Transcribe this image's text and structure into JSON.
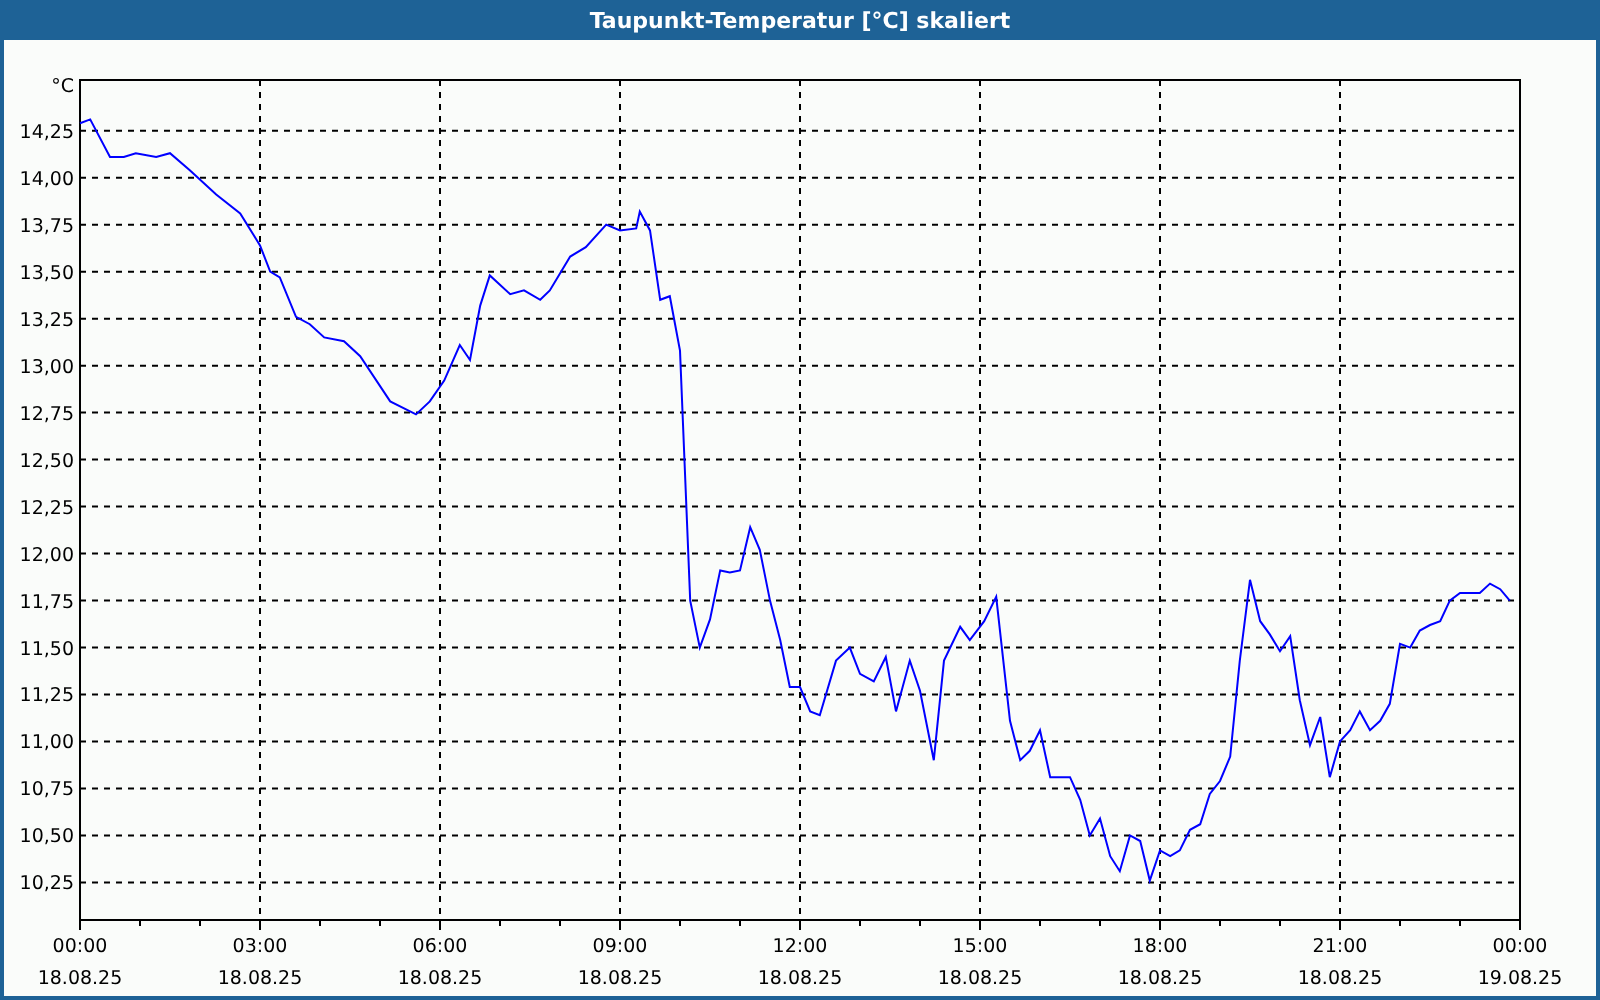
{
  "window": {
    "title": "Taupunkt-Temperatur [°C] skaliert"
  },
  "chart": {
    "date_labels": [
      "18.08.25",
      "18.08.25",
      "18.08.25",
      "18.08.25",
      "18.08.25",
      "18.08.25",
      "18.08.25",
      "18.08.25",
      "19.08.25"
    ],
    "chart_data": {
      "type": "line",
      "ylabel": "°C",
      "x": [
        0,
        0.17,
        0.5,
        0.73,
        0.93,
        1.27,
        1.5,
        1.83,
        2.27,
        2.67,
        3.0,
        3.17,
        3.33,
        3.6,
        3.83,
        4.07,
        4.4,
        4.67,
        5.17,
        5.6,
        5.83,
        6.07,
        6.33,
        6.5,
        6.67,
        6.83,
        7.17,
        7.4,
        7.67,
        7.83,
        8.17,
        8.43,
        8.77,
        9.0,
        9.27,
        9.33,
        9.5,
        9.67,
        9.83,
        10.0,
        10.17,
        10.33,
        10.5,
        10.67,
        10.83,
        11.0,
        11.17,
        11.33,
        11.5,
        11.67,
        11.83,
        12.0,
        12.17,
        12.33,
        12.6,
        12.83,
        13.0,
        13.23,
        13.43,
        13.6,
        13.83,
        14.0,
        14.23,
        14.4,
        14.67,
        14.83,
        15.07,
        15.27,
        15.5,
        15.67,
        15.83,
        16.0,
        16.17,
        16.5,
        16.67,
        16.83,
        17.0,
        17.17,
        17.33,
        17.5,
        17.67,
        17.83,
        18.0,
        18.17,
        18.33,
        18.5,
        18.67,
        18.83,
        19.0,
        19.17,
        19.33,
        19.5,
        19.67,
        19.83,
        20.0,
        20.17,
        20.33,
        20.5,
        20.67,
        20.83,
        21.0,
        21.17,
        21.33,
        21.5,
        21.67,
        21.83,
        22.0,
        22.17,
        22.33,
        22.5,
        22.67,
        22.83,
        23.0,
        23.33,
        23.5,
        23.67,
        23.83
      ],
      "grid": true,
      "series": [
        {
          "color": "#0000ff",
          "values": [
            14.29,
            14.31,
            14.11,
            14.11,
            14.13,
            14.11,
            14.13,
            14.04,
            13.91,
            13.81,
            13.64,
            13.5,
            13.47,
            13.26,
            13.22,
            13.15,
            13.13,
            13.05,
            12.81,
            12.74,
            12.81,
            12.92,
            13.11,
            13.03,
            13.32,
            13.48,
            13.38,
            13.4,
            13.35,
            13.4,
            13.58,
            13.63,
            13.75,
            13.72,
            13.73,
            13.82,
            13.72,
            13.35,
            13.37,
            13.08,
            11.75,
            11.5,
            11.65,
            11.91,
            11.9,
            11.91,
            12.14,
            12.02,
            11.75,
            11.54,
            11.29,
            11.29,
            11.16,
            11.14,
            11.43,
            11.5,
            11.36,
            11.32,
            11.45,
            11.16,
            11.43,
            11.27,
            10.9,
            11.43,
            11.61,
            11.54,
            11.64,
            11.77,
            11.11,
            10.9,
            10.95,
            11.06,
            10.81,
            10.81,
            10.69,
            10.5,
            10.59,
            10.39,
            10.31,
            10.5,
            10.47,
            10.26,
            10.42,
            10.39,
            10.42,
            10.53,
            10.56,
            10.72,
            10.79,
            10.92,
            11.43,
            11.86,
            11.64,
            11.57,
            11.48,
            11.56,
            11.22,
            10.98,
            11.13,
            10.81,
            11.0,
            11.06,
            11.16,
            11.06,
            11.11,
            11.2,
            11.52,
            11.5,
            11.59,
            11.62,
            11.64,
            11.75,
            11.79,
            11.79,
            11.84,
            11.81,
            11.75
          ]
        }
      ],
      "xlim": [
        0,
        24
      ],
      "ylim": [
        10.05,
        14.52
      ],
      "xticks": [
        {
          "value": 0,
          "label": "00:00"
        },
        {
          "value": 3,
          "label": "03:00"
        },
        {
          "value": 6,
          "label": "06:00"
        },
        {
          "value": 9,
          "label": "09:00"
        },
        {
          "value": 12,
          "label": "12:00"
        },
        {
          "value": 15,
          "label": "15:00"
        },
        {
          "value": 18,
          "label": "18:00"
        },
        {
          "value": 21,
          "label": "21:00"
        },
        {
          "value": 24,
          "label": "00:00"
        }
      ],
      "yticks": [
        {
          "value": 10.25,
          "label": "10,25"
        },
        {
          "value": 10.5,
          "label": "10,50"
        },
        {
          "value": 10.75,
          "label": "10,75"
        },
        {
          "value": 11,
          "label": "11,00"
        },
        {
          "value": 11.25,
          "label": "11,25"
        },
        {
          "value": 11.5,
          "label": "11,50"
        },
        {
          "value": 11.75,
          "label": "11,75"
        },
        {
          "value": 12,
          "label": "12,00"
        },
        {
          "value": 12.25,
          "label": "12,25"
        },
        {
          "value": 12.5,
          "label": "12,50"
        },
        {
          "value": 12.75,
          "label": "12,75"
        },
        {
          "value": 13,
          "label": "13,00"
        },
        {
          "value": 13.25,
          "label": "13,25"
        },
        {
          "value": 13.5,
          "label": "13,50"
        },
        {
          "value": 13.75,
          "label": "13,75"
        },
        {
          "value": 14,
          "label": "14,00"
        },
        {
          "value": 14.25,
          "label": "14,25"
        }
      ]
    }
  }
}
